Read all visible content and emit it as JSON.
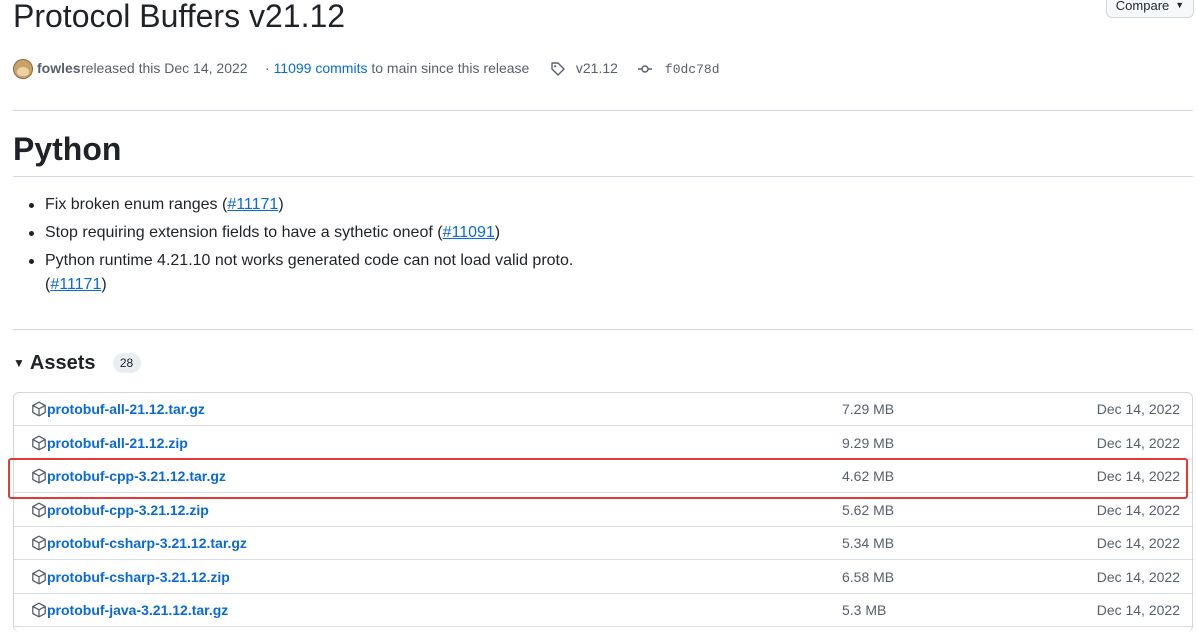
{
  "release": {
    "title": "Protocol Buffers v21.12",
    "compare_label": "Compare",
    "author": "fowles",
    "released_text": "released this Dec 14, 2022",
    "commits_prefix": "· ",
    "commits_link": "11099 commits",
    "commits_suffix": " to main since this release",
    "tag": "v21.12",
    "commit": "f0dc78d"
  },
  "section": {
    "heading": "Python",
    "notes": [
      {
        "text_before": "Fix broken enum ranges (",
        "link": "#11171",
        "text_after": ")"
      },
      {
        "text_before": "Stop requiring extension fields to have a sythetic oneof (",
        "link": "#11091",
        "text_after": ")"
      },
      {
        "text_before": "Python runtime 4.21.10 not works generated code can not load valid proto.",
        "text_line2_before": "(",
        "link": "#11171",
        "text_after": ")"
      }
    ]
  },
  "assets": {
    "label": "Assets",
    "count": "28",
    "items": [
      {
        "name": "protobuf-all-21.12.tar.gz",
        "size": "7.29 MB",
        "date": "Dec 14, 2022"
      },
      {
        "name": "protobuf-all-21.12.zip",
        "size": "9.29 MB",
        "date": "Dec 14, 2022"
      },
      {
        "name": "protobuf-cpp-3.21.12.tar.gz",
        "size": "4.62 MB",
        "date": "Dec 14, 2022"
      },
      {
        "name": "protobuf-cpp-3.21.12.zip",
        "size": "5.62 MB",
        "date": "Dec 14, 2022"
      },
      {
        "name": "protobuf-csharp-3.21.12.tar.gz",
        "size": "5.34 MB",
        "date": "Dec 14, 2022"
      },
      {
        "name": "protobuf-csharp-3.21.12.zip",
        "size": "6.58 MB",
        "date": "Dec 14, 2022"
      },
      {
        "name": "protobuf-java-3.21.12.tar.gz",
        "size": "5.3 MB",
        "date": "Dec 14, 2022"
      }
    ]
  },
  "colors": {
    "link": "#0969da",
    "highlight": "#e53935",
    "text_muted": "#57606a"
  },
  "icons": {
    "package": "package-icon",
    "tag": "tag-icon",
    "commit": "git-commit-icon",
    "caret": "triangle-down-icon"
  }
}
